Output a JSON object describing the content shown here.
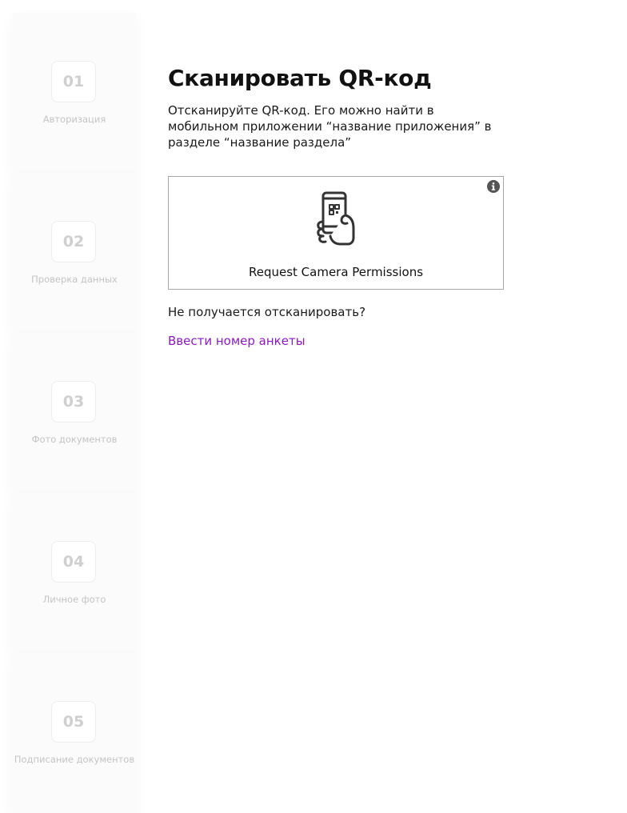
{
  "steps": [
    {
      "number": "01",
      "label": "Авторизация"
    },
    {
      "number": "02",
      "label": "Проверка данных"
    },
    {
      "number": "03",
      "label": "Фото документов"
    },
    {
      "number": "04",
      "label": "Личное фото"
    },
    {
      "number": "05",
      "label": "Подписание документов"
    }
  ],
  "main": {
    "title": "Сканировать QR-код",
    "description": "Отсканируйте QR-код. Его можно найти в мобильном приложении “название приложения” в разделе “название раздела”",
    "scanner": {
      "button_label": "Request Camera Permissions",
      "info_icon": "info-icon",
      "phone_icon": "phone-qr-scan-icon"
    },
    "help_text": "Не получается отсканировать?",
    "manual_entry_link": "Ввести номер анкеты"
  },
  "colors": {
    "link": "#8a1bbd",
    "step_text": "#c4c4c4",
    "border": "#a8a8a8"
  }
}
